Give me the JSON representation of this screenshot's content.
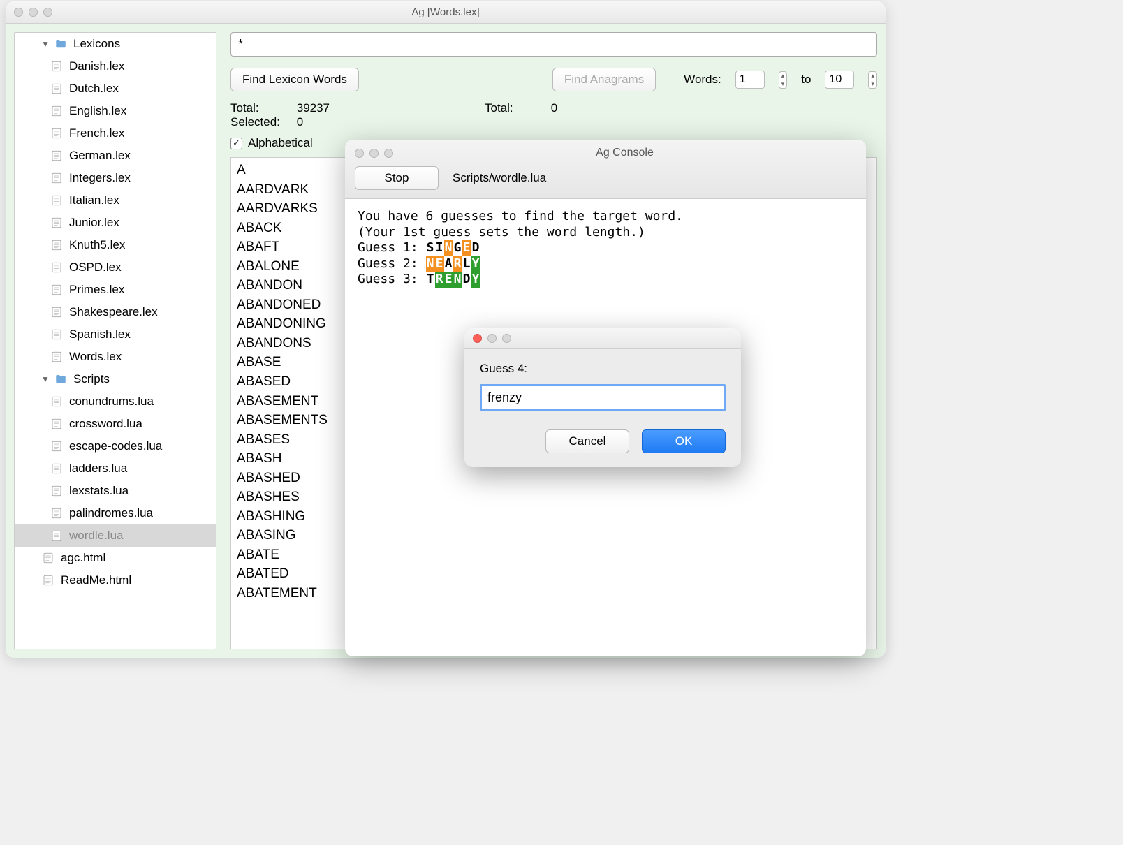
{
  "window": {
    "title": "Ag [Words.lex]"
  },
  "sidebar": {
    "folders": [
      {
        "name": "Lexicons",
        "expanded": true,
        "items": [
          "Danish.lex",
          "Dutch.lex",
          "English.lex",
          "French.lex",
          "German.lex",
          "Integers.lex",
          "Italian.lex",
          "Junior.lex",
          "Knuth5.lex",
          "OSPD.lex",
          "Primes.lex",
          "Shakespeare.lex",
          "Spanish.lex",
          "Words.lex"
        ]
      },
      {
        "name": "Scripts",
        "expanded": true,
        "items": [
          "conundrums.lua",
          "crossword.lua",
          "escape-codes.lua",
          "ladders.lua",
          "lexstats.lua",
          "palindromes.lua",
          "wordle.lua"
        ],
        "selected": "wordle.lua"
      }
    ],
    "root_files": [
      "agc.html",
      "ReadMe.html"
    ]
  },
  "search": {
    "pattern": "*"
  },
  "buttons": {
    "find_lexicon": "Find Lexicon Words",
    "find_anagrams": "Find Anagrams"
  },
  "words_range": {
    "label": "Words:",
    "from": "1",
    "to_label": "to",
    "to": "10"
  },
  "stats": {
    "left": {
      "total_label": "Total:",
      "total": "39237",
      "selected_label": "Selected:",
      "selected": "0"
    },
    "right": {
      "total_label": "Total:",
      "total": "0"
    }
  },
  "alphabetical": {
    "checked": true,
    "label": "Alphabetical"
  },
  "wordlist": [
    "A",
    "AARDVARK",
    "AARDVARKS",
    "ABACK",
    "ABAFT",
    "ABALONE",
    "ABANDON",
    "ABANDONED",
    "ABANDONING",
    "ABANDONS",
    "ABASE",
    "ABASED",
    "ABASEMENT",
    "ABASEMENTS",
    "ABASES",
    "ABASH",
    "ABASHED",
    "ABASHES",
    "ABASHING",
    "ABASING",
    "ABATE",
    "ABATED",
    "ABATEMENT"
  ],
  "console": {
    "title": "Ag Console",
    "stop": "Stop",
    "script_path": "Scripts/wordle.lua",
    "intro1": "You have 6 guesses to find the target word.",
    "intro2": "(Your 1st guess sets the word length.)",
    "guess_label_1": "Guess 1: ",
    "guess_label_2": "Guess 2: ",
    "guess_label_3": "Guess 3: ",
    "guesses": [
      {
        "letters": [
          {
            "c": "S",
            "h": "none"
          },
          {
            "c": "I",
            "h": "none"
          },
          {
            "c": "N",
            "h": "orange"
          },
          {
            "c": "G",
            "h": "none"
          },
          {
            "c": "E",
            "h": "orange"
          },
          {
            "c": "D",
            "h": "none"
          }
        ]
      },
      {
        "letters": [
          {
            "c": "N",
            "h": "orange"
          },
          {
            "c": "E",
            "h": "orange"
          },
          {
            "c": "A",
            "h": "none"
          },
          {
            "c": "R",
            "h": "orange"
          },
          {
            "c": "L",
            "h": "none"
          },
          {
            "c": "Y",
            "h": "green"
          }
        ]
      },
      {
        "letters": [
          {
            "c": "T",
            "h": "none"
          },
          {
            "c": "R",
            "h": "green"
          },
          {
            "c": "E",
            "h": "green"
          },
          {
            "c": "N",
            "h": "green"
          },
          {
            "c": "D",
            "h": "none"
          },
          {
            "c": "Y",
            "h": "green"
          }
        ]
      }
    ]
  },
  "dialog": {
    "prompt": "Guess 4:",
    "value": "frenzy",
    "cancel": "Cancel",
    "ok": "OK"
  }
}
